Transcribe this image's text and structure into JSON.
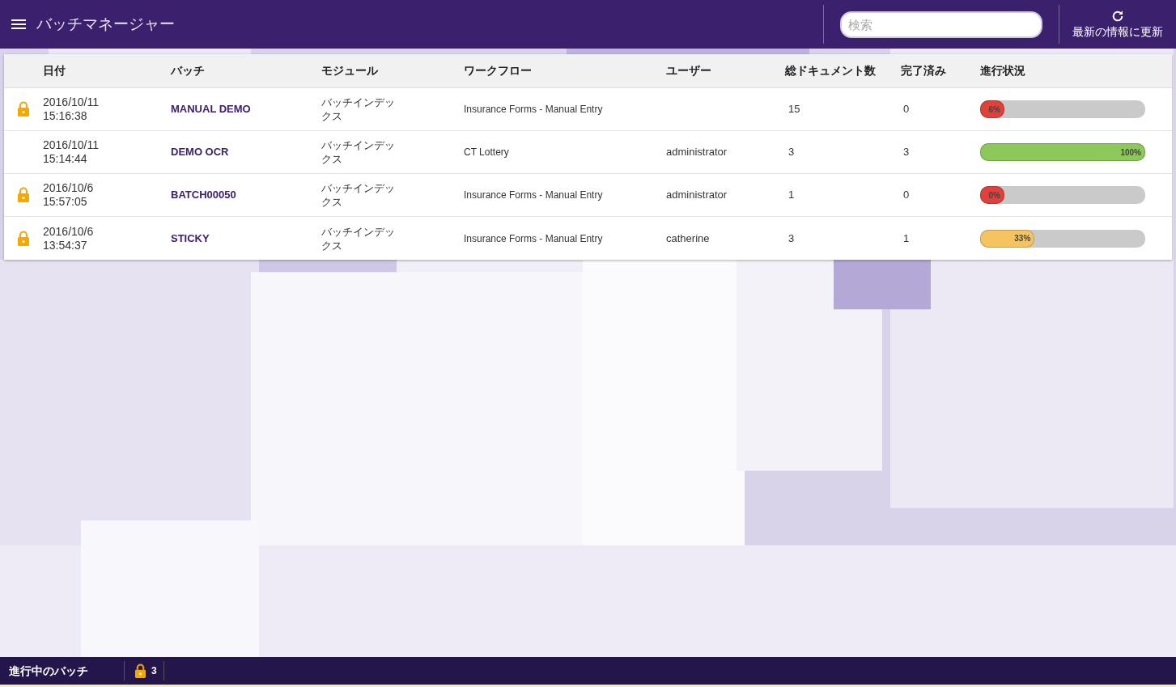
{
  "header": {
    "title": "バッチマネージャー",
    "search": {
      "placeholder": "検索"
    },
    "refresh_label": "最新の情報に更新"
  },
  "table": {
    "columns": [
      "日付",
      "バッチ",
      "モジュール",
      "ワークフロー",
      "ユーザー",
      "総ドキュメント数",
      "完了済み",
      "進行状況"
    ],
    "rows": [
      {
        "locked": true,
        "date": "2016/10/11",
        "time": "15:16:38",
        "batch": "MANUAL DEMO",
        "module": "バッチインデックス",
        "workflow": "Insurance Forms - Manual Entry",
        "user": "",
        "total": "15",
        "done": "0",
        "progress": {
          "level": 0.06,
          "label": "6%",
          "color": "#e0413a"
        }
      },
      {
        "locked": false,
        "date": "2016/10/11",
        "time": "15:14:44",
        "batch": "DEMO OCR",
        "module": "バッチインデックス",
        "workflow": "CT Lottery",
        "user": "administrator",
        "total": "3",
        "done": "3",
        "progress": {
          "level": 1,
          "label": "100%",
          "color": "#8cc85a"
        }
      },
      {
        "locked": true,
        "date": "2016/10/6",
        "time": "15:57:05",
        "batch": "BATCH00050",
        "module": "バッチインデックス",
        "workflow": "Insurance Forms - Manual Entry",
        "user": "administrator",
        "total": "1",
        "done": "0",
        "progress": {
          "level": 0,
          "label": "0%",
          "color": "#e0413a"
        }
      },
      {
        "locked": true,
        "date": "2016/10/6",
        "time": "13:54:37",
        "batch": "STICKY",
        "module": "バッチインデックス",
        "workflow": "Insurance Forms - Manual Entry",
        "user": "catherine",
        "total": "3",
        "done": "1",
        "progress": {
          "level": 0.33,
          "label": "33%",
          "color": "#f5c460"
        }
      }
    ]
  },
  "status_bar": {
    "label": "進行中のバッチ",
    "locked_count": "3"
  }
}
